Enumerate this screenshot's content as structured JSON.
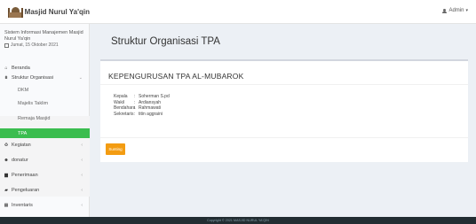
{
  "header": {
    "app_title": "Masjid Nurul Ya'qin",
    "user_label": "Admin",
    "user_caret": "▾"
  },
  "sidebar": {
    "system_title": "Sistem Informasi Manajemen Masjid Nurul Ya'qin",
    "date": "Jumat, 15 Oktober 2021",
    "menu": [
      {
        "label": "Beranda",
        "icon": "home-icon",
        "glyph": "⌂"
      },
      {
        "label": "Struktur Organisasi",
        "icon": "sitemap-icon",
        "glyph": "⩩",
        "chevron": "⌄"
      },
      {
        "label": "Kegiatan",
        "icon": "recycle-icon",
        "glyph": "♻",
        "chevron": "‹"
      },
      {
        "label": "donatur",
        "icon": "users-icon",
        "glyph": "☻",
        "chevron": "‹"
      },
      {
        "label": "Penerimaan",
        "icon": "folder-icon",
        "glyph": "▆",
        "chevron": "‹"
      },
      {
        "label": "Pengeluaran",
        "icon": "folder-open-icon",
        "glyph": "▰",
        "chevron": "‹"
      },
      {
        "label": "Inventaris",
        "icon": "table-icon",
        "glyph": "▦",
        "chevron": "‹"
      }
    ],
    "submenu": [
      "DKM",
      "Majelis Taklim",
      "Remaja Masjid",
      "TPA"
    ]
  },
  "content": {
    "page_title": "Struktur Organisasi TPA",
    "panel_title": "KEPENGURUSAN TPA AL-MUBAROK",
    "rows": [
      {
        "label": "Kepala",
        "sep": ":",
        "value": "Soherman S.pd"
      },
      {
        "label": "Wakil",
        "sep": ":",
        "value": "Ardiansyah"
      },
      {
        "label": "Bendahara",
        "sep": ":",
        "value": "Rahmawati"
      },
      {
        "label": "Sekretaris",
        "sep": ":",
        "value": "titin aggraini"
      }
    ],
    "button_label": "Sunting"
  },
  "footer": {
    "text": "Copyright © 2021 MASJID NURUL YA'QIN"
  },
  "colors": {
    "active_menu": "#3bbd4f",
    "button": "#f39c12",
    "footer_bg": "#222d32"
  }
}
